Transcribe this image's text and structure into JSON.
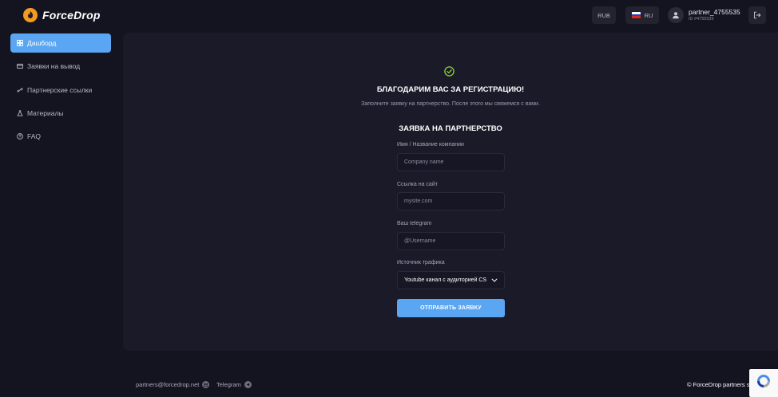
{
  "brand": {
    "name": "ForceDrop",
    "accent": "#5aa6f3",
    "logo_color": "#f39a1f"
  },
  "sidebar": {
    "items": [
      {
        "label": "Дашборд",
        "icon": "grid-icon",
        "active": true
      },
      {
        "label": "Заявки на вывод",
        "icon": "wallet-icon",
        "active": false
      },
      {
        "label": "Партнерские ссылки",
        "icon": "link-icon",
        "active": false
      },
      {
        "label": "Материалы",
        "icon": "flask-icon",
        "active": false
      },
      {
        "label": "FAQ",
        "icon": "question-icon",
        "active": false
      }
    ]
  },
  "header": {
    "currency": "RUB",
    "language": "RU",
    "user": {
      "name": "partner_4755535",
      "id": "ID #4755535"
    }
  },
  "main": {
    "thanks_title": "БЛАГОДАРИМ ВАС ЗА РЕГИСТРАЦИЮ!",
    "thanks_subtitle": "Заполните заявку на партнерство. После этого мы свяжемся с вами.",
    "form_title": "ЗАЯВКА НА ПАРТНЕРСТВО",
    "fields": [
      {
        "label": "Имя / Название компании",
        "placeholder": "Company name"
      },
      {
        "label": "Ссылка на сайт",
        "placeholder": "mysite.com"
      },
      {
        "label": "Ваш telegram",
        "placeholder": "@Username"
      }
    ],
    "traffic": {
      "label": "Источник трафика",
      "selected": "Youtube канал с аудиторией CS"
    },
    "submit_label": "ОТПРАВИТЬ ЗАЯВКУ"
  },
  "footer": {
    "email": "partners@forcedrop.net",
    "telegram": "Telegram",
    "copyright": "© ForceDrop partners s"
  }
}
